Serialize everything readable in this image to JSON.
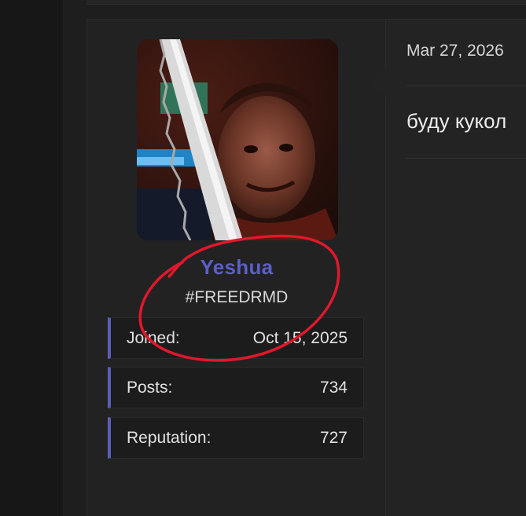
{
  "post": {
    "author": {
      "username": "Yeshua",
      "title": "#FREEDRMD",
      "avatar_icon": "avatar-image",
      "stats": [
        {
          "label": "Joined:",
          "value": "Oct 15, 2025"
        },
        {
          "label": "Posts:",
          "value": "734"
        },
        {
          "label": "Reputation:",
          "value": "727"
        }
      ]
    },
    "date": "Mar 27, 2026",
    "body": "буду кукол"
  },
  "colors": {
    "username": "#5b5fc7",
    "stat_accent": "#5a5fb5",
    "annotation_circle": "#e0182b",
    "background": "#1a1a1b"
  }
}
